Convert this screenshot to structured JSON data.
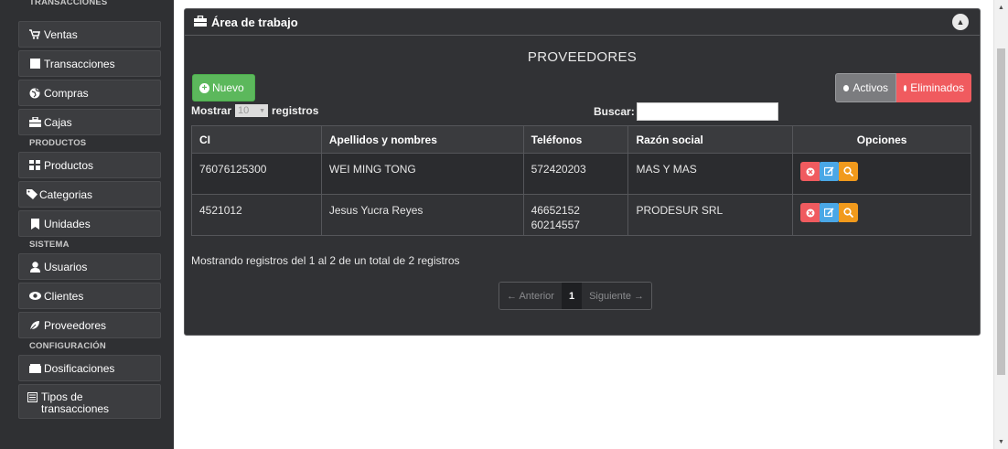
{
  "sidebar": {
    "sections": [
      {
        "label": "TRANSACCIONES",
        "items": [
          {
            "label": "Ventas",
            "icon": "cart-icon"
          },
          {
            "label": "Transacciones",
            "icon": "square-icon"
          },
          {
            "label": "Compras",
            "icon": "globe-icon"
          },
          {
            "label": "Cajas",
            "icon": "briefcase-icon"
          }
        ]
      },
      {
        "label": "PRODUCTOS",
        "items": [
          {
            "label": "Productos",
            "icon": "cubes-icon"
          },
          {
            "label": "Categorias",
            "icon": "tags-icon"
          },
          {
            "label": "Unidades",
            "icon": "bookmark-icon"
          }
        ]
      },
      {
        "label": "SISTEMA",
        "items": [
          {
            "label": "Usuarios",
            "icon": "user-icon"
          },
          {
            "label": "Clientes",
            "icon": "eye-icon"
          },
          {
            "label": "Proveedores",
            "icon": "leaf-icon"
          }
        ]
      },
      {
        "label": "CONFIGURACIÓN",
        "items": [
          {
            "label": "Dosificaciones",
            "icon": "inbox-icon"
          },
          {
            "label": "Tipos de transacciones",
            "icon": "list-icon"
          }
        ]
      }
    ]
  },
  "panel": {
    "title": "Área de trabajo",
    "heading": "PROVEEDORES",
    "new_button": "Nuevo",
    "toggle": {
      "active": "Activos",
      "deleted": "Eliminados"
    },
    "length": {
      "prefix": "Mostrar",
      "value": "10",
      "suffix": "registros"
    },
    "search_label": "Buscar:",
    "search_value": "",
    "table": {
      "headers": [
        "CI",
        "Apellidos y nombres",
        "Teléfonos",
        "Razón social",
        "Opciones"
      ],
      "rows": [
        {
          "ci": "76076125300",
          "name": "WEI MING TONG",
          "phone1": "572420203",
          "phone2": "",
          "company": "MAS Y MAS"
        },
        {
          "ci": "4521012",
          "name": "Jesus Yucra Reyes",
          "phone1": "46652152",
          "phone2": "60214557",
          "company": "PRODESUR SRL"
        }
      ]
    },
    "info": "Mostrando registros del 1 al 2 de un total de 2 registros",
    "pager": {
      "prev": "← Anterior",
      "current": "1",
      "next": "Siguiente →"
    }
  },
  "colors": {
    "new": "#5cb85c",
    "delete": "#f05b5f",
    "edit": "#4aa7e6",
    "view": "#f19a1c"
  }
}
